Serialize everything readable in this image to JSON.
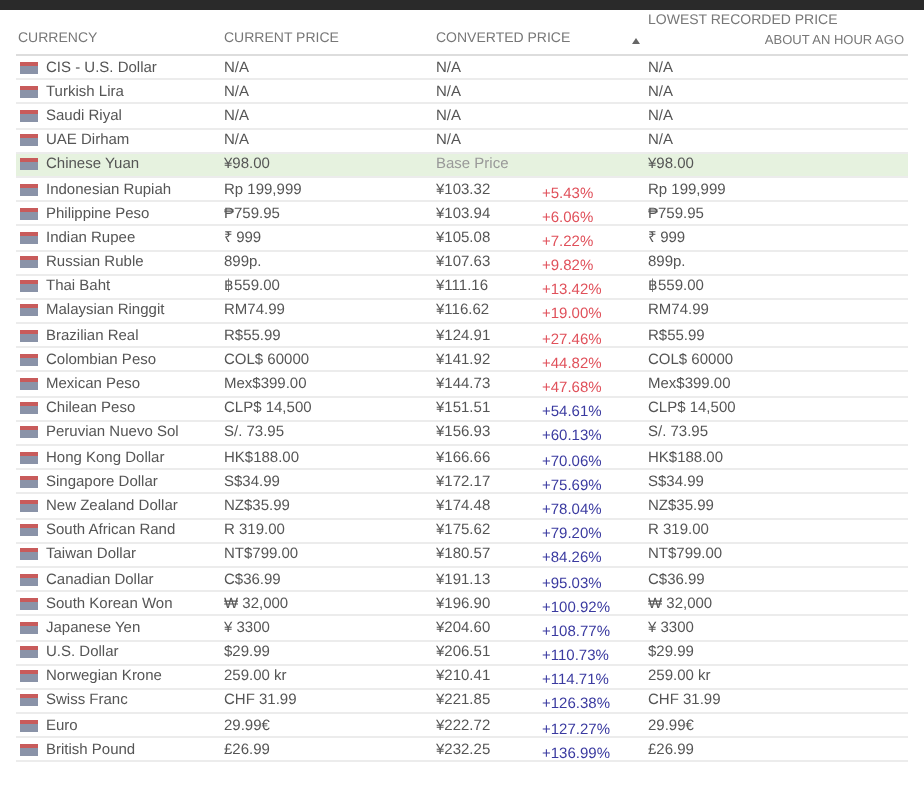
{
  "table": {
    "columns": [
      {
        "label": "CURRENCY"
      },
      {
        "label": "CURRENT PRICE"
      },
      {
        "label": "CONVERTED PRICE",
        "sorted": true
      },
      {
        "label": "LOWEST RECORDED PRICE",
        "note": "ABOUT AN HOUR AGO"
      }
    ],
    "rows": [
      {
        "currency": "CIS - U.S. Dollar",
        "current": "N/A",
        "converted": "N/A",
        "lowest": "N/A",
        "highlighted": false
      },
      {
        "currency": "Turkish Lira",
        "current": "N/A",
        "converted": "N/A",
        "lowest": "N/A",
        "highlighted": false
      },
      {
        "currency": "Saudi Riyal",
        "current": "N/A",
        "converted": "N/A",
        "lowest": "N/A",
        "highlighted": false
      },
      {
        "currency": "UAE Dirham",
        "current": "N/A",
        "converted": "N/A",
        "lowest": "N/A",
        "highlighted": false
      },
      {
        "currency": "Chinese Yuan",
        "current": "¥98.00",
        "converted": "Base Price",
        "lowest": "¥98.00",
        "highlighted": true
      },
      {
        "currency": "Indonesian Rupiah",
        "current": "Rp 199,999",
        "converted": "¥103.32",
        "change": "+5.43%",
        "color": "#e0505a",
        "lowest": "Rp 199,999",
        "highlighted": false
      },
      {
        "currency": "Philippine Peso",
        "current": "₱759.95",
        "converted": "¥103.94",
        "change": "+6.06%",
        "color": "#e0505a",
        "lowest": "₱759.95",
        "highlighted": false
      },
      {
        "currency": "Indian Rupee",
        "current": "₹ 999",
        "converted": "¥105.08",
        "change": "+7.22%",
        "color": "#e0505a",
        "lowest": "₹ 999",
        "highlighted": false
      },
      {
        "currency": "Russian Ruble",
        "current": "899p.",
        "converted": "¥107.63",
        "change": "+9.82%",
        "color": "#e0505a",
        "lowest": "899p.",
        "highlighted": false
      },
      {
        "currency": "Thai Baht",
        "current": "฿559.00",
        "converted": "¥111.16",
        "change": "+13.42%",
        "color": "#e0505a",
        "lowest": "฿559.00",
        "highlighted": false
      },
      {
        "currency": "Malaysian Ringgit",
        "current": "RM74.99",
        "converted": "¥116.62",
        "change": "+19.00%",
        "color": "#e0505a",
        "lowest": "RM74.99",
        "highlighted": false
      },
      {
        "currency": "Brazilian Real",
        "current": "R$55.99",
        "converted": "¥124.91",
        "change": "+27.46%",
        "color": "#e0505a",
        "lowest": "R$55.99",
        "highlighted": false
      },
      {
        "currency": "Colombian Peso",
        "current": "COL$ 60000",
        "converted": "¥141.92",
        "change": "+44.82%",
        "color": "#e0505a",
        "lowest": "COL$ 60000",
        "highlighted": false
      },
      {
        "currency": "Mexican Peso",
        "current": "Mex$399.00",
        "converted": "¥144.73",
        "change": "+47.68%",
        "color": "#e0505a",
        "lowest": "Mex$399.00",
        "highlighted": false
      },
      {
        "currency": "Chilean Peso",
        "current": "CLP$ 14,500",
        "converted": "¥151.51",
        "change": "+54.61%",
        "color": "#3a3aa0",
        "lowest": "CLP$ 14,500",
        "highlighted": false
      },
      {
        "currency": "Peruvian Nuevo Sol",
        "current": "S/. 73.95",
        "converted": "¥156.93",
        "change": "+60.13%",
        "color": "#3a3aa0",
        "lowest": "S/. 73.95",
        "highlighted": false
      },
      {
        "currency": "Hong Kong Dollar",
        "current": "HK$188.00",
        "converted": "¥166.66",
        "change": "+70.06%",
        "color": "#3a3aa0",
        "lowest": "HK$188.00",
        "highlighted": false
      },
      {
        "currency": "Singapore Dollar",
        "current": "S$34.99",
        "converted": "¥172.17",
        "change": "+75.69%",
        "color": "#3a3aa0",
        "lowest": "S$34.99",
        "highlighted": false
      },
      {
        "currency": "New Zealand Dollar",
        "current": "NZ$35.99",
        "converted": "¥174.48",
        "change": "+78.04%",
        "color": "#3a3aa0",
        "lowest": "NZ$35.99",
        "highlighted": false
      },
      {
        "currency": "South African Rand",
        "current": "R 319.00",
        "converted": "¥175.62",
        "change": "+79.20%",
        "color": "#3a3aa0",
        "lowest": "R 319.00",
        "highlighted": false
      },
      {
        "currency": "Taiwan Dollar",
        "current": "NT$799.00",
        "converted": "¥180.57",
        "change": "+84.26%",
        "color": "#3a3aa0",
        "lowest": "NT$799.00",
        "highlighted": false
      },
      {
        "currency": "Canadian Dollar",
        "current": "C$36.99",
        "converted": "¥191.13",
        "change": "+95.03%",
        "color": "#3a3aa0",
        "lowest": "C$36.99",
        "highlighted": false
      },
      {
        "currency": "South Korean Won",
        "current": "₩ 32,000",
        "converted": "¥196.90",
        "change": "+100.92%",
        "color": "#3a3aa0",
        "lowest": "₩ 32,000",
        "highlighted": false
      },
      {
        "currency": "Japanese Yen",
        "current": "¥ 3300",
        "converted": "¥204.60",
        "change": "+108.77%",
        "color": "#3a3aa0",
        "lowest": "¥ 3300",
        "highlighted": false
      },
      {
        "currency": "U.S. Dollar",
        "current": "$29.99",
        "converted": "¥206.51",
        "change": "+110.73%",
        "color": "#3a3aa0",
        "lowest": "$29.99",
        "highlighted": false
      },
      {
        "currency": "Norwegian Krone",
        "current": "259.00 kr",
        "converted": "¥210.41",
        "change": "+114.71%",
        "color": "#3a3aa0",
        "lowest": "259.00 kr",
        "highlighted": false
      },
      {
        "currency": "Swiss Franc",
        "current": "CHF 31.99",
        "converted": "¥221.85",
        "change": "+126.38%",
        "color": "#3a3aa0",
        "lowest": "CHF 31.99",
        "highlighted": false
      },
      {
        "currency": "Euro",
        "current": "29.99€",
        "converted": "¥222.72",
        "change": "+127.27%",
        "color": "#3a3aa0",
        "lowest": "29.99€",
        "highlighted": false
      },
      {
        "currency": "British Pound",
        "current": "£26.99",
        "converted": "¥232.25",
        "change": "+136.99%",
        "color": "#3a3aa0",
        "lowest": "£26.99",
        "highlighted": false
      }
    ]
  }
}
